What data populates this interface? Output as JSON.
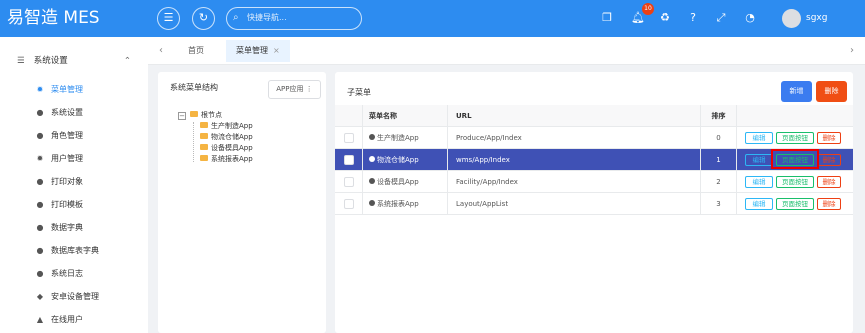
{
  "app": {
    "title": "易智造 MES"
  },
  "topbar": {
    "search_placeholder": "快捷导航...",
    "notification_count": "10",
    "username": "sgxg"
  },
  "sidebar": {
    "group_title": "系统设置",
    "items": [
      {
        "label": "菜单管理",
        "active": true,
        "icon": "gear-icon"
      },
      {
        "label": "系统设置",
        "icon": "circle-icon"
      },
      {
        "label": "角色管理",
        "icon": "circle-icon"
      },
      {
        "label": "用户管理",
        "icon": "gear-icon"
      },
      {
        "label": "打印对象",
        "icon": "circle-icon"
      },
      {
        "label": "打印模板",
        "icon": "circle-icon"
      },
      {
        "label": "数据字典",
        "icon": "circle-icon"
      },
      {
        "label": "数据库表字典",
        "icon": "circle-icon"
      },
      {
        "label": "系统日志",
        "icon": "circle-icon"
      },
      {
        "label": "安卓设备管理",
        "icon": "android-icon"
      },
      {
        "label": "在线用户",
        "icon": "user-icon"
      }
    ]
  },
  "tabs": [
    {
      "label": "首页"
    },
    {
      "label": "菜单管理",
      "active": true
    }
  ],
  "left_panel": {
    "title": "系统菜单结构",
    "app_button": "APP应用 ⋮",
    "tree": {
      "root": "根节点",
      "children": [
        "生产制造App",
        "物流仓储App",
        "设备模具App",
        "系统报表App"
      ]
    }
  },
  "right_panel": {
    "title": "子菜单",
    "add_button": "新增",
    "delete_button": "删除",
    "columns": [
      "菜单名称",
      "URL",
      "排序"
    ],
    "rows": [
      {
        "name": "生产制造App",
        "url": "Produce/App/Index",
        "order": "0",
        "selected": false
      },
      {
        "name": "物流仓储App",
        "url": "wms/App/Index",
        "order": "1",
        "selected": true
      },
      {
        "name": "设备模具App",
        "url": "Facility/App/Index",
        "order": "2",
        "selected": false
      },
      {
        "name": "系统报表App",
        "url": "Layout/AppList",
        "order": "3",
        "selected": false
      }
    ],
    "action_labels": {
      "edit": "编辑",
      "page_buttons": "页面按钮",
      "remove": "删除"
    }
  },
  "colors": {
    "primary": "#2d8cf0",
    "selected_row": "#3f51b5",
    "danger": "#f04e14"
  }
}
